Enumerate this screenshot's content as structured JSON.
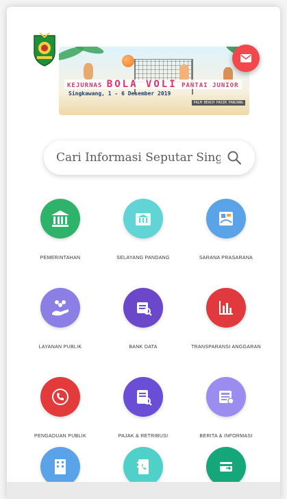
{
  "header": {
    "logo_icon": "regional-crest-icon",
    "banner": {
      "event_prefix": "KEJURNAS",
      "event_main": "BOLA VOLI",
      "event_suffix": "PANTAI JUNIOR",
      "location_date": "Singkawang, 1 - 6 Desember 2019",
      "venue": "PALM BEACH PASIR PANJANG"
    },
    "mail_button_icon": "mail-icon"
  },
  "search": {
    "placeholder": "Cari Informasi Seputar Singka…",
    "icon": "search-icon"
  },
  "menu": [
    {
      "label": "PEMERINTAHAN",
      "icon": "government-building-icon",
      "color": "#2fb36b"
    },
    {
      "label": "SELAYANG PANDANG",
      "icon": "city-hall-icon",
      "color": "#62d4d6"
    },
    {
      "label": "SARANA PRASARANA",
      "icon": "infrastructure-map-icon",
      "color": "#5ba3e8"
    },
    {
      "label": "LAYANAN PUBLIK",
      "icon": "public-service-icon",
      "color": "#8b7fe6"
    },
    {
      "label": "BANK DATA",
      "icon": "database-icon",
      "color": "#6b47c9"
    },
    {
      "label": "TRANSPARANSI ANGGARAN",
      "icon": "budget-chart-icon",
      "color": "#e0393e"
    },
    {
      "label": "PENGADUAN PUBLIK",
      "icon": "phone-complaint-icon",
      "color": "#e33b3b"
    },
    {
      "label": "PAJAK & RETRIBUSI",
      "icon": "tax-document-icon",
      "color": "#6a4fd6"
    },
    {
      "label": "BERITA & INFORMASI",
      "icon": "news-icon",
      "color": "#9b8df0"
    },
    {
      "label": "",
      "icon": "office-building-icon",
      "color": "#5ba3e8"
    },
    {
      "label": "",
      "icon": "contact-book-icon",
      "color": "#4fd1c9"
    },
    {
      "label": "",
      "icon": "card-transfer-icon",
      "color": "#15a77a"
    }
  ]
}
